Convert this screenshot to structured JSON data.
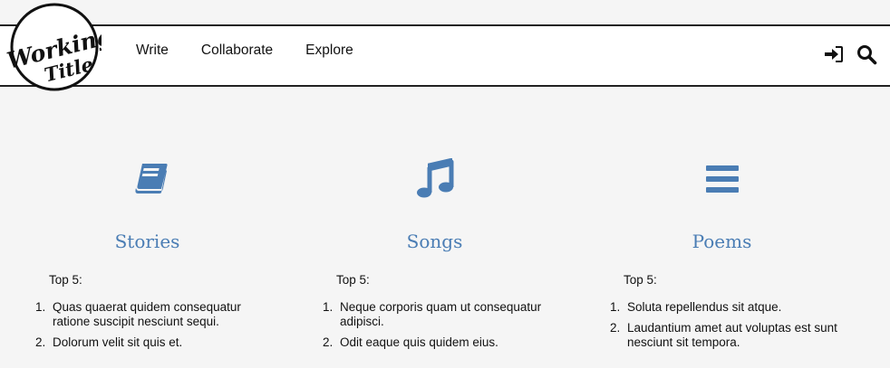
{
  "nav": {
    "logo_text_1": "Working",
    "logo_text_2": "Title",
    "links": [
      "Write",
      "Collaborate",
      "Explore"
    ]
  },
  "accent_color": "#4a7db4",
  "categories": [
    {
      "title": "Stories",
      "icon": "book-icon",
      "top_label": "Top 5:",
      "items": [
        "Quas quaerat quidem consequatur ratione suscipit nesciunt sequi.",
        "Dolorum velit sit quis et."
      ]
    },
    {
      "title": "Songs",
      "icon": "music-note-icon",
      "top_label": "Top 5:",
      "items": [
        "Neque corporis quam ut consequatur adipisci.",
        "Odit eaque quis quidem eius."
      ]
    },
    {
      "title": "Poems",
      "icon": "lines-icon",
      "top_label": "Top 5:",
      "items": [
        "Soluta repellendus sit atque.",
        "Laudantium amet aut voluptas est sunt nesciunt sit tempora."
      ]
    }
  ]
}
